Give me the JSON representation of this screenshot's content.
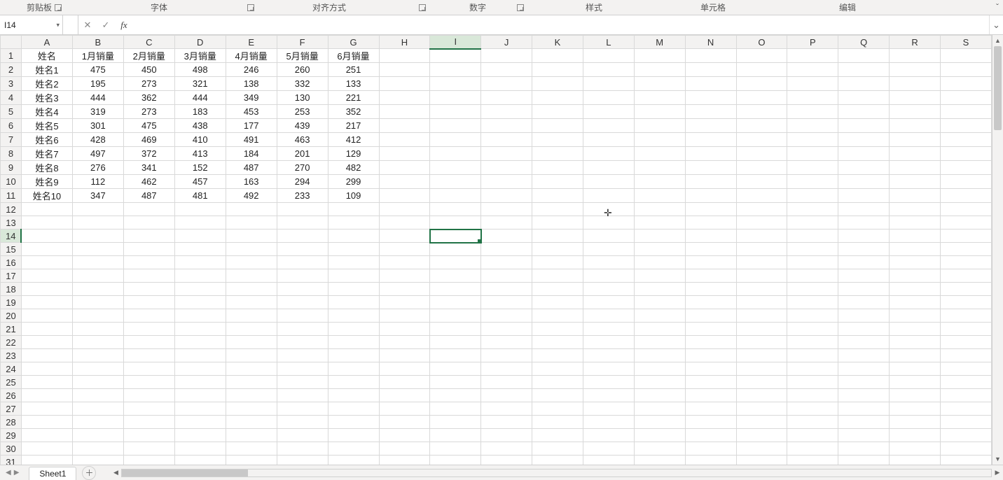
{
  "ribbon_groups": {
    "clipboard": "剪贴板",
    "font": "字体",
    "alignment": "对齐方式",
    "number": "数字",
    "styles": "样式",
    "cells": "单元格",
    "editing": "编辑"
  },
  "name_box": "I14",
  "formula": "",
  "columns": [
    "A",
    "B",
    "C",
    "D",
    "E",
    "F",
    "G",
    "H",
    "I",
    "J",
    "K",
    "L",
    "M",
    "N",
    "O",
    "P",
    "Q",
    "R",
    "S"
  ],
  "row_count": 31,
  "selected": {
    "col_index": 8,
    "row_index": 14
  },
  "headers": [
    "姓名",
    "1月销量",
    "2月销量",
    "3月销量",
    "4月销量",
    "5月销量",
    "6月销量"
  ],
  "rows": [
    {
      "name": "姓名1",
      "v": [
        475,
        450,
        498,
        246,
        260,
        251
      ]
    },
    {
      "name": "姓名2",
      "v": [
        195,
        273,
        321,
        138,
        332,
        133
      ]
    },
    {
      "name": "姓名3",
      "v": [
        444,
        362,
        444,
        349,
        130,
        221
      ]
    },
    {
      "name": "姓名4",
      "v": [
        319,
        273,
        183,
        453,
        253,
        352
      ]
    },
    {
      "name": "姓名5",
      "v": [
        301,
        475,
        438,
        177,
        439,
        217
      ]
    },
    {
      "name": "姓名6",
      "v": [
        428,
        469,
        410,
        491,
        463,
        412
      ]
    },
    {
      "name": "姓名7",
      "v": [
        497,
        372,
        413,
        184,
        201,
        129
      ]
    },
    {
      "name": "姓名8",
      "v": [
        276,
        341,
        152,
        487,
        270,
        482
      ]
    },
    {
      "name": "姓名9",
      "v": [
        112,
        462,
        457,
        163,
        294,
        299
      ]
    },
    {
      "name": "姓名10",
      "v": [
        347,
        487,
        481,
        492,
        233,
        109
      ]
    }
  ],
  "sheet_tab": "Sheet1"
}
